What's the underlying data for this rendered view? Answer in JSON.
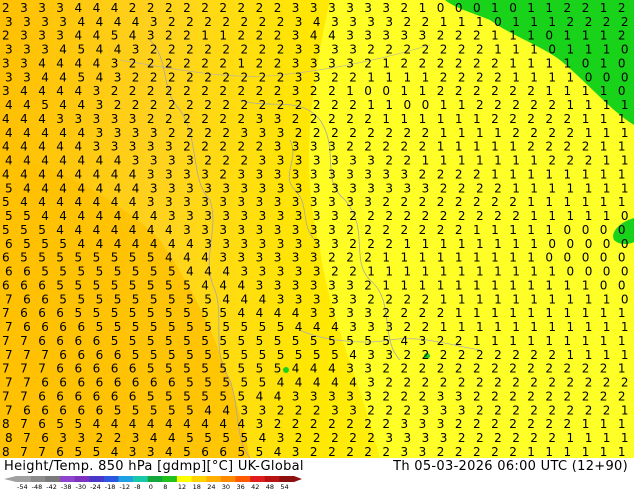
{
  "title": {
    "left": "Height/Temp. 850 hPa [gdmp][°C] UK-Global",
    "right": "Th 05-03-2026 06:00 UTC (12+90)"
  },
  "colorbar": {
    "labels": [
      "-54",
      "-48",
      "-42",
      "-38",
      "-30",
      "-24",
      "-18",
      "-12",
      "-8",
      "0",
      "8",
      "12",
      "18",
      "24",
      "30",
      "36",
      "42",
      "48",
      "54"
    ],
    "colors": [
      "#a0a0a0",
      "#8c8c8c",
      "#7a7a7a",
      "#8e44cc",
      "#7d33c0",
      "#4a36c8",
      "#2a56e0",
      "#1fa0e0",
      "#18c8a8",
      "#12a83c",
      "#22c21c",
      "#ffff00",
      "#ffd300",
      "#ffb000",
      "#ff8a00",
      "#ff5a00",
      "#e01c1c",
      "#b81414",
      "#8c1010"
    ]
  },
  "map": {
    "field_colors": {
      "green": "#19d21a",
      "yellow_light": "#ffff28",
      "yellow": "#ffe800",
      "orange_light": "#ffd21e",
      "orange": "#ffc000",
      "cyan": "#28f0c8"
    },
    "rows": [
      "2 3 3 3 4 4 4 2 2 2 2 2 2 2 2 2 3 3 3 3 3 3 2 1 0 0 0 1 0 1 1 2 2 1 2",
      "3 3 3 3 4 4 4 4 3 2 2 2 2 2 2 2 3 4 3 3 3 3 2 2 1 1 1 0 1 1 1 2 2 2 2",
      "2 3 3 3 4 4 5 4 3 2 2 1 1 2 2 2 3 4 4 3 3 3 3 3 2 2 2 1 1 1 0 1 1 1 2",
      "3 3 3 4 5 4 4 3 2 2 2 2 2 2 2 2 3 3 3 3 2 2 2 2 2 2 2 1 1 1 0 1 1 1 0",
      "3 3 4 4 4 4 3 2 2 2 2 2 2 1 2 2 3 3 3 3 2 1 2 2 2 2 2 2 1 1 1 1 0 1 0",
      "3 3 4 4 5 4 3 2 2 2 2 2 2 2 2 2 3 3 2 2 1 1 1 1 2 2 2 2 1 1 1 1 0 0 0",
      "3 4 4 4 4 3 2 2 2 2 2 2 2 2 2 2 3 2 2 1 0 0 1 1 2 2 2 2 2 2 1 1 1 1 0",
      "4 4 5 4 4 3 2 2 2 2 2 2 2 2 2 2 2 2 2 2 1 1 0 0 1 1 2 2 2 2 2 1 1 1 1",
      "4 4 4 3 3 3 3 3 2 2 2 2 2 2 3 3 2 2 2 2 2 1 1 1 1 1 1 2 2 2 2 2 1 1 1",
      "4 4 4 4 4 3 3 3 3 2 2 2 2 3 3 3 2 2 2 2 2 2 2 2 1 1 1 1 2 2 2 2 1 1 1",
      "4 4 4 4 4 3 3 3 3 3 2 2 2 2 2 3 3 3 3 2 2 2 2 2 1 1 1 1 1 2 2 2 2 1 1",
      "4 4 4 4 4 4 4 3 3 3 3 2 2 2 3 3 3 3 3 3 3 2 2 1 1 1 1 1 1 1 2 2 2 1 1",
      "4 4 4 4 4 4 4 4 3 3 3 3 2 3 3 3 3 3 3 3 3 3 3 2 2 2 2 1 1 1 1 1 1 1 1",
      "5 4 4 4 4 4 4 4 3 3 3 3 3 3 3 3 3 3 3 3 3 3 3 3 2 2 2 2 1 1 1 1 1 1 1",
      "5 4 4 4 4 4 4 4 3 3 3 3 3 3 3 3 3 3 3 3 3 2 2 2 2 2 2 2 2 1 1 1 1 1 1",
      "5 5 4 4 4 4 4 4 4 3 3 3 3 3 3 3 3 3 3 2 2 2 2 2 2 2 2 2 2 1 1 1 1 1 0",
      "5 5 5 4 4 4 4 4 4 4 3 3 3 3 3 3 3 3 3 2 2 2 2 2 2 2 1 1 1 1 1 0 0 0 0",
      "6 5 5 5 4 4 4 4 4 4 4 3 3 3 3 3 3 3 3 2 2 2 1 1 1 1 1 1 1 1 0 0 0 0 0",
      "6 5 5 5 5 5 5 5 5 4 4 4 3 3 3 3 3 3 2 2 2 1 1 1 1 1 1 1 1 1 0 0 0 0 0",
      "6 6 5 5 5 5 5 5 5 5 4 4 4 3 3 3 3 3 2 2 1 1 1 1 1 1 1 1 1 1 1 0 0 0 0",
      "6 6 6 5 5 5 5 5 5 5 5 4 4 4 3 3 3 3 3 3 2 1 1 1 1 1 1 1 1 1 1 1 1 0 0",
      "7 6 6 5 5 5 5 5 5 5 5 5 4 4 4 3 3 3 3 3 2 2 2 2 1 1 1 1 1 1 1 1 1 1 0",
      "7 6 6 6 5 5 5 5 5 5 5 5 5 4 4 4 4 3 3 3 3 2 2 2 2 1 1 1 1 1 1 1 1 1 1",
      "7 6 6 6 6 5 5 5 5 5 5 5 5 5 5 5 4 4 4 3 3 3 2 2 1 1 1 1 1 1 1 1 1 1 1",
      "7 7 6 6 6 6 5 5 5 5 5 5 5 5 5 5 5 5 5 5 5 5 4 3 2 2 1 1 1 1 1 1 1 1 1",
      "7 7 7 6 6 6 6 5 5 5 5 5 5 5 5 5 5 5 5 4 3 3 2 2 2 2 2 2 2 2 2 1 1 1 1",
      "7 7 7 6 6 6 6 6 5 5 5 5 5 5 5 5 4 4 4 3 3 2 2 2 2 2 2 2 2 2 2 2 2 2 1",
      "7 7 6 6 6 6 6 6 6 6 5 5 5 5 5 4 4 4 4 4 3 2 2 2 2 2 2 2 2 2 2 2 2 2 2",
      "7 7 6 6 6 6 6 6 5 5 5 5 5 5 4 4 3 3 3 3 3 2 2 2 3 3 2 2 2 2 2 2 2 2 2",
      "7 6 6 6 6 6 5 5 5 5 5 4 4 3 3 2 2 2 3 3 2 2 2 3 3 3 2 2 2 2 2 2 2 2 1",
      "8 7 6 5 5 4 4 4 4 4 4 4 4 4 3 2 2 2 2 2 2 2 3 3 3 2 2 2 2 2 2 2 1 1 1",
      "8 7 6 3 3 2 2 3 4 4 5 5 5 5 4 3 2 2 2 2 2 3 3 3 3 2 2 2 2 2 2 1 1 1 1",
      "8 7 7 6 5 5 4 3 3 4 5 6 6 5 5 4 3 2 2 2 2 2 3 3 2 2 2 2 2 1 1 1 1 1 1"
    ]
  }
}
